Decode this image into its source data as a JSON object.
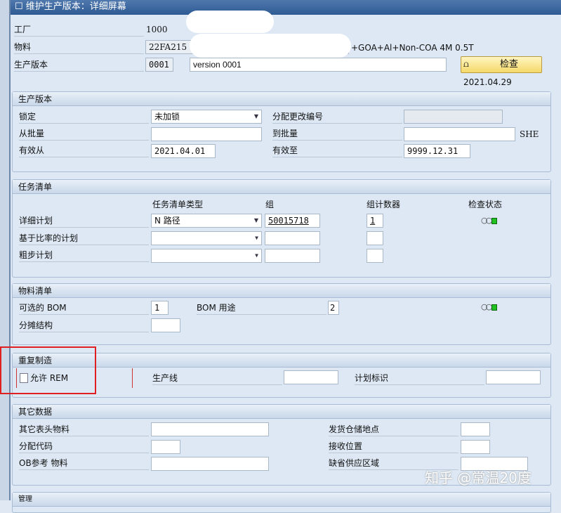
{
  "window": {
    "title": "维护生产版本：详细屏幕"
  },
  "header": {
    "plant_label": "工厂",
    "plant_value": "1000",
    "material_label": "物料",
    "material_value": "22FA215",
    "material_desc": "+GOA+Al+Non-COA 4M 0.5T",
    "version_label": "生产版本",
    "version_value": "0001",
    "version_text": "version 0001",
    "check_button": "检查",
    "check_date": "2021.04.29"
  },
  "prod_version": {
    "title": "生产版本",
    "lock_label": "锁定",
    "lock_value": "未加锁",
    "change_no_label": "分配更改编号",
    "from_lot_label": "从批量",
    "to_lot_label": "到批量",
    "unit": "SHE",
    "valid_from_label": "有效从",
    "valid_from": "2021.04.01",
    "valid_to_label": "有效至",
    "valid_to": "9999.12.31"
  },
  "task_list": {
    "title": "任务清单",
    "col_type": "任务清单类型",
    "col_group": "组",
    "col_counter": "组计数器",
    "col_status": "检查状态",
    "rows": [
      {
        "label": "详细计划",
        "type": "N 路径",
        "group": "50015718",
        "counter": "1"
      },
      {
        "label": "基于比率的计划",
        "type": "",
        "group": "",
        "counter": ""
      },
      {
        "label": "粗步计划",
        "type": "",
        "group": "",
        "counter": ""
      }
    ]
  },
  "bom": {
    "title": "物料清单",
    "alt_label": "可选的 BOM",
    "alt_value": "1",
    "usage_label": "BOM 用途",
    "usage_value": "2",
    "apportion_label": "分摊结构"
  },
  "rem": {
    "title": "重复制造",
    "allow_label": "允许 REM",
    "allow_checked": false,
    "line_label": "生产线",
    "plan_id_label": "计划标识"
  },
  "other": {
    "title": "其它数据",
    "other_header_label": "其它表头物料",
    "issue_sloc_label": "发货仓储地点",
    "apportion_code_label": "分配代码",
    "receive_label": "接收位置",
    "ob_ref_label": "OB参考 物料",
    "supply_area_label": "缺省供应区域"
  },
  "admin": {
    "title": "管理"
  },
  "watermark": "知乎 @常温20度"
}
